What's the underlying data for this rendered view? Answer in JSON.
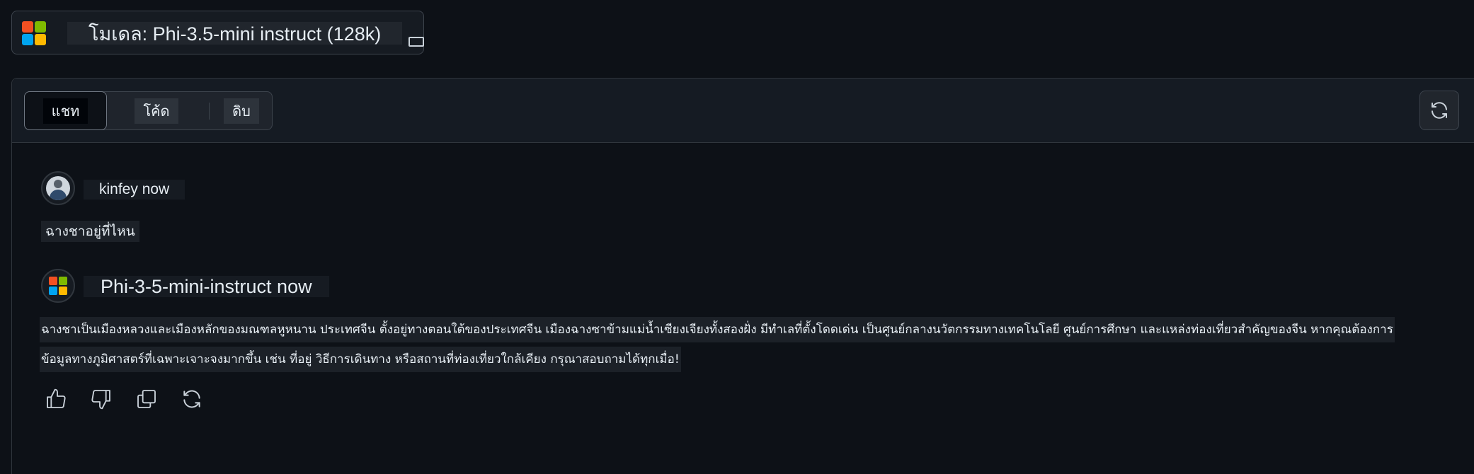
{
  "model_selector": {
    "label": "โมเดล: Phi-3.5-mini instruct (128k)",
    "logo_colors": [
      "#f25022",
      "#7fba00",
      "#00a4ef",
      "#ffb900"
    ],
    "collapse_icon": "window-icon"
  },
  "tabs": [
    {
      "label": "แชท",
      "active": true
    },
    {
      "label": "โค้ด",
      "active": false
    },
    {
      "label": "ดิบ",
      "active": false
    }
  ],
  "toolbar": {
    "refresh_icon": "refresh-icon"
  },
  "messages": [
    {
      "author": "kinfey now",
      "avatar": "user-avatar",
      "lines": [
        "ฉางชาอยู่ที่ไหน"
      ]
    },
    {
      "author": "Phi-3-5-mini-instruct now",
      "avatar": "microsoft-logo",
      "lines": [
        "ฉางชาเป็นเมืองหลวงและเมืองหลักของมณฑลหูหนาน ประเทศจีน ตั้งอยู่ทางตอนใต้ของประเทศจีน เมืองฉางซาข้ามแม่น้ำเซียงเจียงทั้งสองฝั่ง มีทำเลที่ตั้งโดดเด่น เป็นศูนย์กลางนวัตกรรมทางเทคโนโลยี ศูนย์การศึกษา และแหล่งท่องเที่ยวสำคัญของจีน หากคุณต้องการ",
        "ข้อมูลทางภูมิศาสตร์ที่เฉพาะเจาะจงมากขึ้น เช่น ที่อยู่ วิธีการเดินทาง หรือสถานที่ท่องเที่ยวใกล้เคียง กรุณาสอบถามได้ทุกเมื่อ!"
      ]
    }
  ],
  "message_actions": [
    "thumbs-up-icon",
    "thumbs-down-icon",
    "copy-icon",
    "regenerate-icon"
  ],
  "colors": {
    "background": "#0d1117",
    "toolbar": "#151b23",
    "border": "#30363d"
  }
}
